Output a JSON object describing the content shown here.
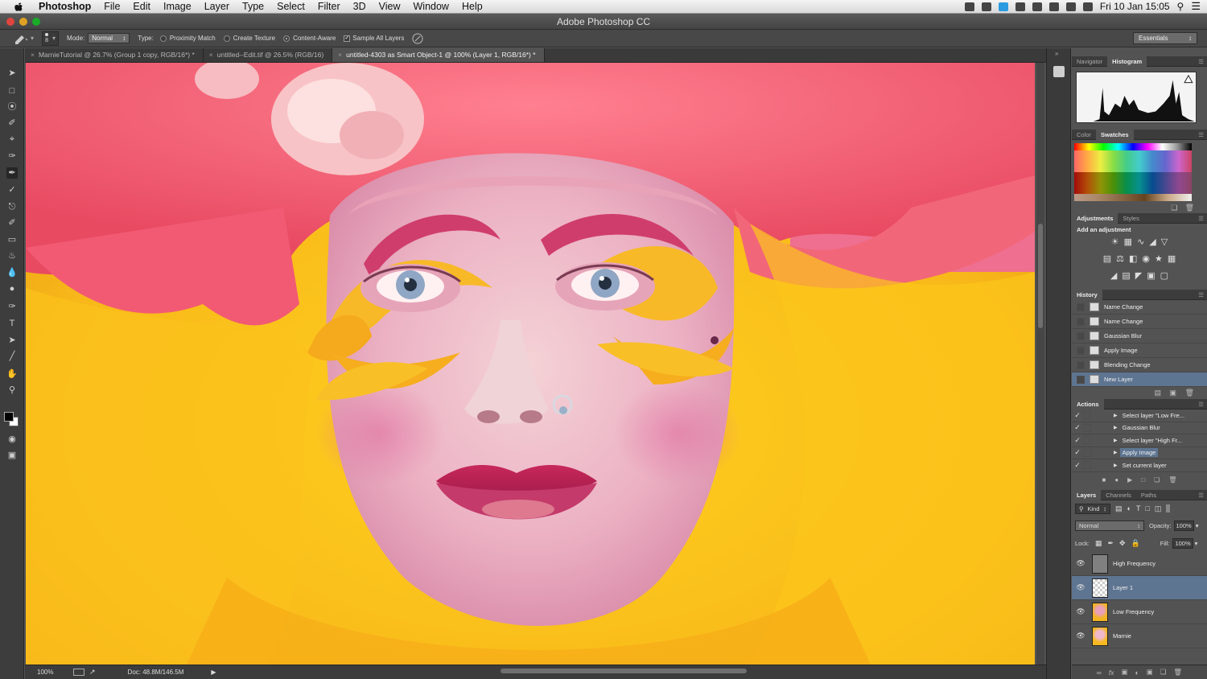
{
  "menubar": {
    "app_name": "Photoshop",
    "items": [
      "File",
      "Edit",
      "Image",
      "Layer",
      "Type",
      "Select",
      "Filter",
      "3D",
      "View",
      "Window",
      "Help"
    ],
    "clock": "Fri 10 Jan  15:05"
  },
  "titlebar": {
    "title": "Adobe Photoshop CC"
  },
  "options": {
    "mode_label": "Mode:",
    "mode_value": "Normal",
    "type_label": "Type:",
    "proximity_match": "Proximity Match",
    "create_texture": "Create Texture",
    "content_aware": "Content-Aware",
    "sample_all_layers": "Sample All Layers",
    "brush_size": "8",
    "workspace": "Essentials"
  },
  "tabs": [
    {
      "label": "MarnieTutorial @ 26.7% (Group 1 copy, RGB/16*) *"
    },
    {
      "label": "untitled--Edit.tif @ 26.5% (RGB/16)"
    },
    {
      "label": "untitled-4303 as Smart Object-1 @ 100% (Layer 1, RGB/16*) *"
    }
  ],
  "status": {
    "zoom": "100%",
    "doc": "Doc: 48.8M/146.5M"
  },
  "panels": {
    "nav_tabs": [
      "Navigator",
      "Histogram"
    ],
    "color_tabs": [
      "Color",
      "Swatches"
    ],
    "adj_tabs": [
      "Adjustments",
      "Styles"
    ],
    "adj_heading": "Add an adjustment",
    "history_title": "History",
    "history": [
      "Name Change",
      "Name Change",
      "Gaussian Blur",
      "Apply Image",
      "Blending Change",
      "New Layer"
    ],
    "actions_title": "Actions",
    "actions": [
      "Select layer \"Low Fre...",
      "Gaussian Blur",
      "Select layer \"High Fr...",
      "Apply Image",
      "Set current layer"
    ],
    "layer_tabs": [
      "Layers",
      "Channels",
      "Paths"
    ],
    "kind_label": "Kind",
    "blend_mode": "Normal",
    "opacity_label": "Opacity:",
    "opacity_value": "100%",
    "lock_label": "Lock:",
    "fill_label": "Fill:",
    "fill_value": "100%",
    "layers": [
      "High Frequency",
      "Layer 1",
      "Low Frequency",
      "Marnie"
    ]
  },
  "colors": {
    "selection": "#5e7591",
    "canvas_yellow": "#f7b020",
    "hair_pink": "#f06275"
  }
}
